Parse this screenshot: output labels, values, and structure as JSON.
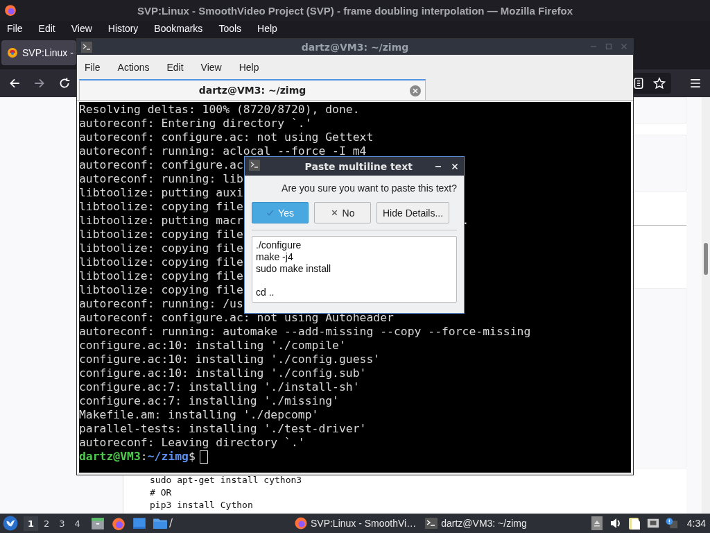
{
  "browser": {
    "title": "SVP:Linux - SmoothVideo Project (SVP) - frame doubling interpolation — Mozilla Firefox",
    "menu": [
      "File",
      "Edit",
      "View",
      "History",
      "Bookmarks",
      "Tools",
      "Help"
    ],
    "tabs": [
      {
        "label": "SVP:Linux -",
        "selected": true
      }
    ],
    "page": {
      "code_lines": [
        "sudo apt-get install cython3",
        "# OR",
        "pip3 install Cython"
      ]
    }
  },
  "terminal": {
    "title": "dartz@VM3: ~/zimg",
    "menu": [
      "File",
      "Actions",
      "Edit",
      "View",
      "Help"
    ],
    "tabs": [
      {
        "label": "dartz@VM3: ~/zimg",
        "selected": true
      }
    ],
    "lines": [
      {
        "text": "Resolving deltas: 100% (8720/8720), done."
      },
      {
        "text": "autoreconf: Entering directory `.'"
      },
      {
        "text": "autoreconf: configure.ac: not using Gettext"
      },
      {
        "text": "autoreconf: running: aclocal --force -I m4"
      },
      {
        "text": "autoreconf: configure.ac"
      },
      {
        "text": "autoreconf: running: lib"
      },
      {
        "text": "libtoolize: putting auxi"
      },
      {
        "text": "libtoolize: copying file"
      },
      {
        "text": "libtoolize: putting macr",
        "tail": "."
      },
      {
        "text": "libtoolize: copying file"
      },
      {
        "text": "libtoolize: copying file"
      },
      {
        "text": "libtoolize: copying file"
      },
      {
        "text": "libtoolize: copying file"
      },
      {
        "text": "libtoolize: copying file"
      },
      {
        "text": "autoreconf: running: /us"
      },
      {
        "text": "autoreconf: configure.ac: not using Autoheader"
      },
      {
        "text": "autoreconf: running: automake --add-missing --copy --force-missing"
      },
      {
        "text": "configure.ac:10: installing './compile'"
      },
      {
        "text": "configure.ac:10: installing './config.guess'"
      },
      {
        "text": "configure.ac:10: installing './config.sub'"
      },
      {
        "text": "configure.ac:7: installing './install-sh'"
      },
      {
        "text": "configure.ac:7: installing './missing'"
      },
      {
        "text": "Makefile.am: installing './depcomp'"
      },
      {
        "text": "parallel-tests: installing './test-driver'"
      },
      {
        "text": "autoreconf: Leaving directory `.'"
      }
    ],
    "prompt": {
      "user_host": "dartz@VM3",
      "separator": ":",
      "path": "~/zimg",
      "symbol": "$"
    }
  },
  "dialog": {
    "title": "Paste multiline text",
    "question": "Are you sure you want to paste this text?",
    "buttons": [
      {
        "kind": "yes",
        "label": "Yes",
        "selected": true
      },
      {
        "kind": "no",
        "label": "No",
        "selected": false
      },
      {
        "kind": "details",
        "label": "Hide Details...",
        "selected": false
      }
    ],
    "text_blocks": [
      [
        "./configure",
        "make -j4",
        "sudo make install"
      ],
      [
        "cd .."
      ]
    ]
  },
  "taskbar": {
    "workspaces": [
      {
        "label": "1",
        "selected": true
      },
      {
        "label": "2",
        "selected": false
      },
      {
        "label": "3",
        "selected": false
      },
      {
        "label": "4",
        "selected": false
      }
    ],
    "folder_label": "/",
    "tasks": [
      {
        "kind": "browser",
        "label": "SVP:Linux - SmoothVi…"
      },
      {
        "kind": "terminal",
        "label": "dartz@VM3: ~/zimg"
      }
    ],
    "clock": "4:34"
  }
}
